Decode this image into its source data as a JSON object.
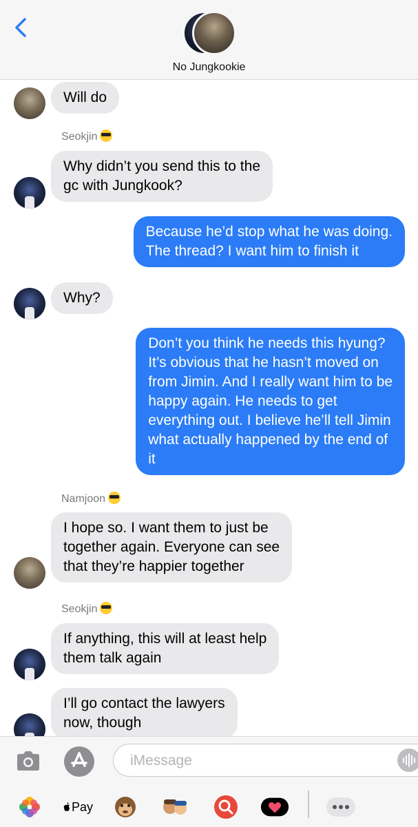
{
  "header": {
    "contact_name": "No Jungkookie"
  },
  "messages": [
    {
      "type": "incoming",
      "sender": "",
      "text": "Will do"
    },
    {
      "type": "incoming",
      "sender": "Seokjin",
      "text": "Why didn’t you send this to the\ngc with Jungkook?"
    },
    {
      "type": "outgoing",
      "text": "Because he’d stop what he was doing.\nThe thread? I want him to finish it"
    },
    {
      "type": "incoming",
      "sender": "",
      "text": "Why?"
    },
    {
      "type": "outgoing",
      "text": "Don’t you think he needs this hyung?\nIt’s obvious that he hasn’t moved on\nfrom Jimin. And I really want him to be\nhappy again. He needs to get\neverything out. I believe he’ll tell Jimin\nwhat actually happened by the end of\nit"
    },
    {
      "type": "incoming",
      "sender": "Namjoon",
      "text": "I hope so. I want them to just be\ntogether again. Everyone can see\nthat they’re happier together"
    },
    {
      "type": "incoming",
      "sender": "Seokjin",
      "text": "If anything, this will at least help\nthem talk again"
    },
    {
      "type": "incoming",
      "sender": "",
      "text": "I’ll go contact the lawyers\nnow, though"
    }
  ],
  "senders": {
    "seokjin_1": "Seokjin",
    "namjoon": "Namjoon",
    "seokjin_2": "Seokjin"
  },
  "composer": {
    "placeholder": "iMessage",
    "value": ""
  },
  "app_drawer": {
    "apple_pay_label": "Pay"
  },
  "colors": {
    "outgoing_bubble": "#2b7cf6",
    "incoming_bubble": "#e9e9eb",
    "accent": "#2b7cf6"
  },
  "icons": [
    "chevron-left-icon",
    "camera-icon",
    "app-store-icon",
    "audio-wave-icon",
    "photos-icon",
    "apple-pay-icon",
    "monkey-memoji-icon",
    "memoji-stickers-icon",
    "search-images-icon",
    "heart-sticker-icon",
    "more-icon"
  ]
}
